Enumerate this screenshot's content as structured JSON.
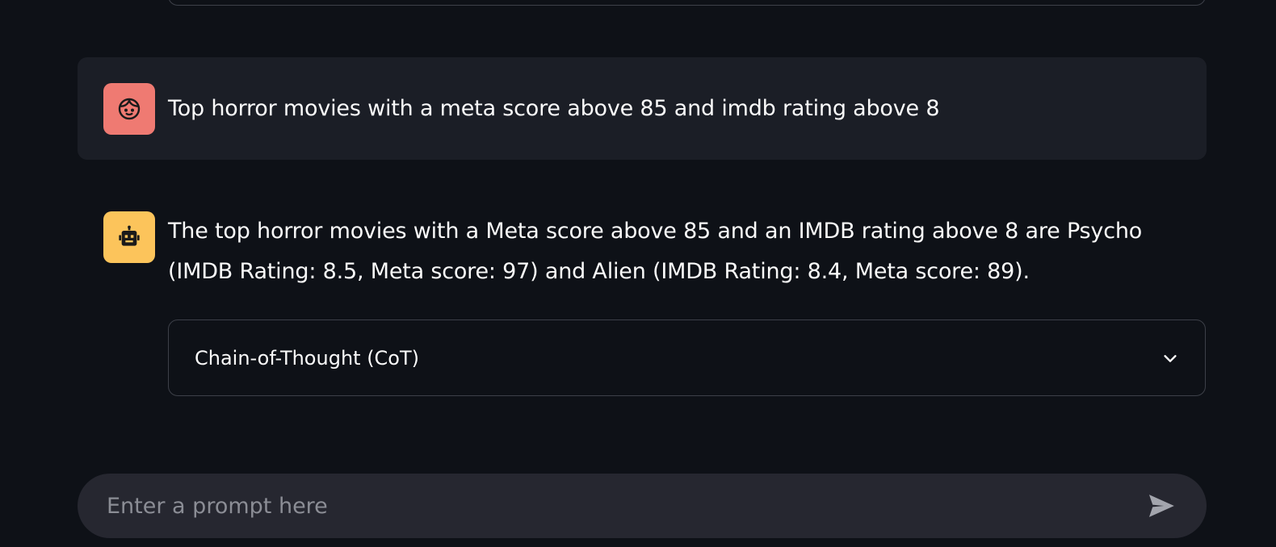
{
  "messages": {
    "user": {
      "avatar_icon": "face-icon",
      "avatar_color": "#ef7a72",
      "text": "Top horror movies with a meta score above 85 and imdb rating above 8"
    },
    "assistant": {
      "avatar_icon": "robot-icon",
      "avatar_color": "#fcc45b",
      "text": "The top horror movies with a Meta score above 85 and an IMDB rating above 8 are Psycho (IMDB Rating: 8.5, Meta score: 97) and Alien (IMDB Rating: 8.4, Meta score: 89).",
      "expander": {
        "label": "Chain-of-Thought (CoT)",
        "icon": "chevron-down-icon",
        "expanded": false
      }
    }
  },
  "chat_input": {
    "placeholder": "Enter a prompt here",
    "value": "",
    "send_icon": "send-icon"
  }
}
